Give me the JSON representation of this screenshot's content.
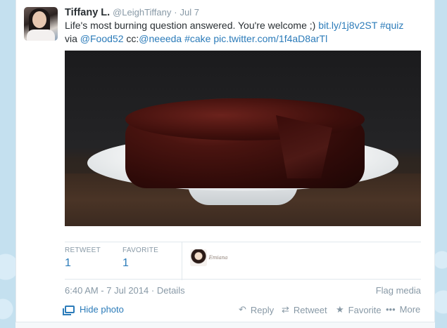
{
  "tweet": {
    "name": "Tiffany L.",
    "handle": "@LeighTiffany",
    "separator": "·",
    "date": "Jul 7",
    "text_part1": "Life's most burning question answered. You're welcome ;) ",
    "link_url": "bit.ly/1j8v2ST",
    "hashtag_quiz": "#quiz",
    "text_via": "via ",
    "mention_food52": "@Food52",
    "text_cc": " cc:",
    "mention_neeeda": "@neeeda",
    "hashtag_cake": "#cake",
    "pic_link": "pic.twitter.com/1f4aD8arTl"
  },
  "stats": {
    "retweet_label": "RETWEET",
    "retweet_count": "1",
    "favorite_label": "FAVORITE",
    "favorite_count": "1",
    "favoriter_name": "Emiana"
  },
  "meta": {
    "timestamp": "6:40 AM - 7 Jul 2014",
    "separator": "·",
    "details": "Details",
    "flag_media": "Flag media"
  },
  "actions": {
    "hide_photo": "Hide photo",
    "reply": "Reply",
    "retweet": "Retweet",
    "favorite": "Favorite",
    "more": "More"
  },
  "icons": {
    "reply": "reply-arrow-icon",
    "retweet": "retweet-icon",
    "favorite": "star-icon",
    "more": "ellipsis-icon",
    "photo": "photo-icon"
  },
  "colors": {
    "link": "#2b7bb9",
    "muted": "#8899a6",
    "text": "#292f33",
    "background": "#c0deed"
  }
}
